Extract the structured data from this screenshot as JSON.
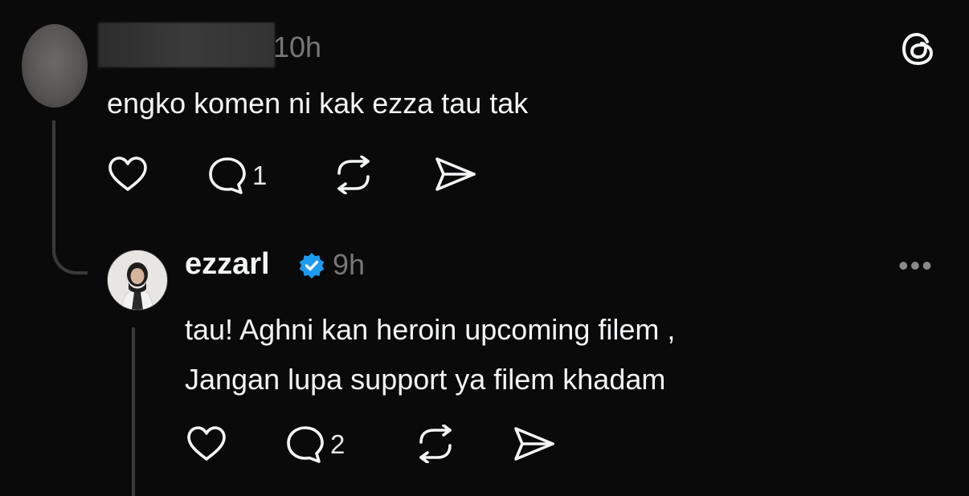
{
  "comment": {
    "time": "10h",
    "text": "engko komen ni kak ezza tau tak",
    "reply_count": "1"
  },
  "reply": {
    "username": "ezzarl",
    "verified": true,
    "time": "9h",
    "more_label": "•••",
    "line1": "tau! Aghni kan heroin upcoming filem ,",
    "line2": "Jangan lupa support ya filem khadam",
    "reply_count": "2"
  },
  "icons": [
    "threads-logo-icon",
    "heart-icon",
    "comment-icon",
    "repost-icon",
    "share-icon",
    "verified-badge-icon",
    "more-icon"
  ],
  "colors": {
    "background": "#0a0a0a",
    "text": "#f3f5f7",
    "muted": "#777777",
    "verified": "#1d9bf0"
  }
}
